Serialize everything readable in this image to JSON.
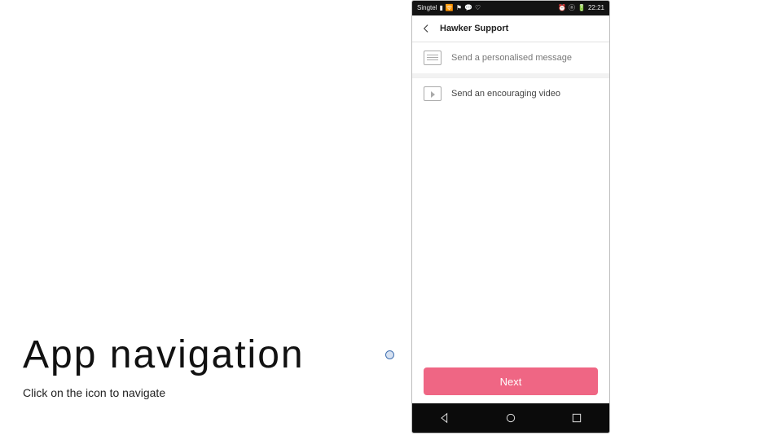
{
  "slide": {
    "title": "App navigation",
    "subtitle": "Click on the icon to navigate"
  },
  "phone": {
    "statusbar": {
      "carrier": "Singtel",
      "time": "22:21"
    },
    "header": {
      "title": "Hawker Support"
    },
    "rows": [
      {
        "icon": "message-icon",
        "label": "Send a personalised message",
        "selected": false
      },
      {
        "icon": "video-icon",
        "label": "Send an encouraging video",
        "selected": true
      }
    ],
    "next_label": "Next"
  }
}
